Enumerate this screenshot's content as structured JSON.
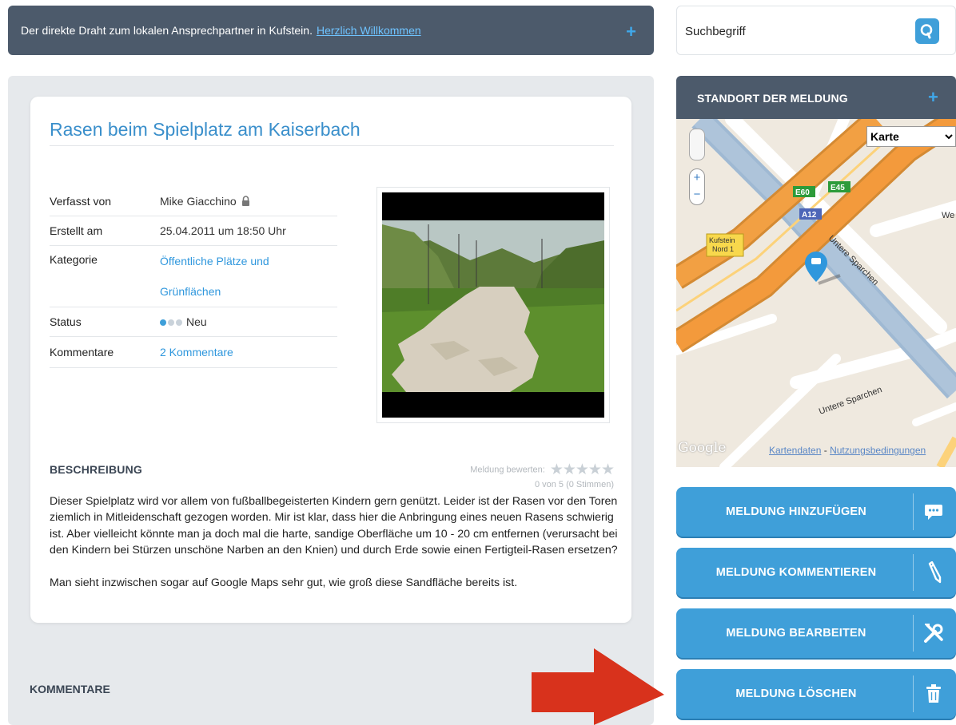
{
  "banner": {
    "text": "Der direkte Draht zum lokalen Ansprechpartner in Kufstein.",
    "link": "Herzlich Willkommen",
    "plus": "+"
  },
  "search": {
    "placeholder": "Suchbegriff"
  },
  "report": {
    "title": "Rasen beim Spielplatz am Kaiserbach",
    "fields": {
      "author_label": "Verfasst von",
      "author_value": "Mike Giacchino",
      "created_label": "Erstellt am",
      "created_value": "25.04.2011 um 18:50 Uhr",
      "category_label": "Kategorie",
      "category_value_1": "Öffentliche Plätze und",
      "category_value_2": "Grünflächen",
      "status_label": "Status",
      "status_value": "Neu",
      "status_level": 1,
      "comments_label": "Kommentare",
      "comments_value": "2 Kommentare"
    },
    "description_heading": "BESCHREIBUNG",
    "rating": {
      "label": "Meldung bewerten:",
      "stars_filled": 0,
      "stars_total": 5,
      "count": "0 von 5 (0 Stimmen)"
    },
    "description_p1": "Dieser Spielplatz wird vor allem von fußballbegeisterten Kindern gern genützt. Leider ist der Rasen vor den Toren ziemlich in Mitleidenschaft gezogen worden. Mir ist klar, dass hier die Anbringung eines neuen Rasens schwierig ist. Aber vielleicht könnte man ja doch mal die harte, sandige Oberfläche um 10 - 20 cm entfernen (verursacht bei den Kindern bei Stürzen unschöne Narben an den Knien) und durch Erde sowie einen Fertigteil-Rasen ersetzen?",
    "description_p2": "Man sieht inzwischen sogar auf Google Maps sehr gut, wie groß diese Sandfläche bereits ist."
  },
  "comments_heading": "KOMMENTARE",
  "map": {
    "heading": "STANDORT DER MELDUNG",
    "plus": "+",
    "type_selected": "Karte",
    "labels": {
      "e60": "E60",
      "e45": "E45",
      "a12": "A12",
      "kufstein_1": "Kufstein",
      "kufstein_2": "Nord 1",
      "street_1": "Untere Sparchen",
      "street_2": "Untere Sparchen",
      "street_edge": "We"
    },
    "google": "Google",
    "credit_1": "Kartendaten",
    "credit_sep": " - ",
    "credit_2": "Nutzungsbedingungen"
  },
  "actions": {
    "add": "MELDUNG HINZUFÜGEN",
    "comment": "MELDUNG KOMMENTIEREN",
    "edit": "MELDUNG BEARBEITEN",
    "delete": "MELDUNG LÖSCHEN"
  },
  "colors": {
    "header_bg": "#4c5a6b",
    "accent": "#3f9fd9",
    "link": "#2f97dd",
    "title": "#3a8fcb",
    "arrow": "#d8321c"
  }
}
